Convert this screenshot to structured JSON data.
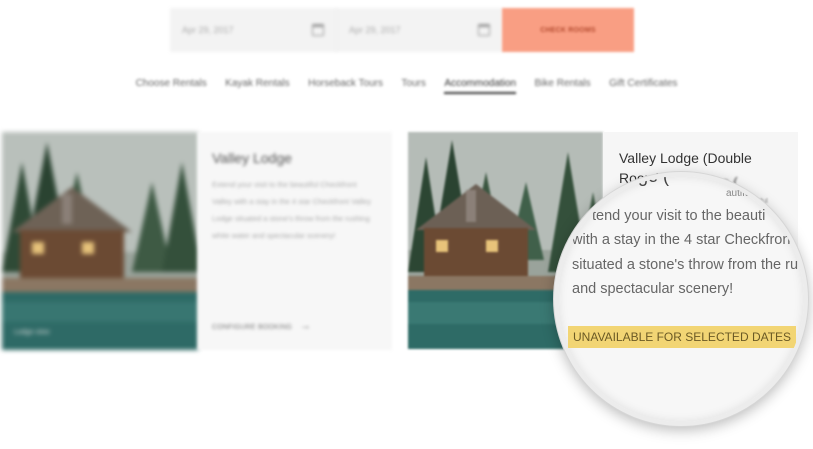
{
  "booking": {
    "date_from": "Apr 29, 2017",
    "date_to": "Apr 29, 2017",
    "check_label": "CHECK ROOMS"
  },
  "nav": [
    {
      "label": "Choose Rentals",
      "active": false
    },
    {
      "label": "Kayak Rentals",
      "active": false
    },
    {
      "label": "Horseback Tours",
      "active": false
    },
    {
      "label": "Tours",
      "active": false
    },
    {
      "label": "Accommodation",
      "active": true
    },
    {
      "label": "Bike Rentals",
      "active": false
    },
    {
      "label": "Gift Certificates",
      "active": false
    }
  ],
  "cards": [
    {
      "title": "Valley Lodge",
      "description": "Extend your visit to the beautiful Checkfront Valley with a stay in the 4 star Checkfront Valley Lodge situated a stone's throw from the rushing white water and spectacular scenery!",
      "image_caption": "Lodge view",
      "link_label": "CONFIGURE BOOKING"
    },
    {
      "title": "Valley Lodge (Double Room)",
      "title_fragment": "odge (",
      "small_fragment": "utiful"
    }
  ],
  "magnifier": {
    "title_fragment": "odge (",
    "side_fragment": "autiful",
    "lines": [
      "tend your visit to the beauti",
      "with a stay in the 4 star Checkfron",
      "situated a stone's throw from the ru",
      "and spectacular scenery!"
    ],
    "badge": "UNAVAILABLE FOR SELECTED DATES"
  },
  "colors": {
    "check_button": "#f99e83",
    "badge": "#f2d574"
  }
}
